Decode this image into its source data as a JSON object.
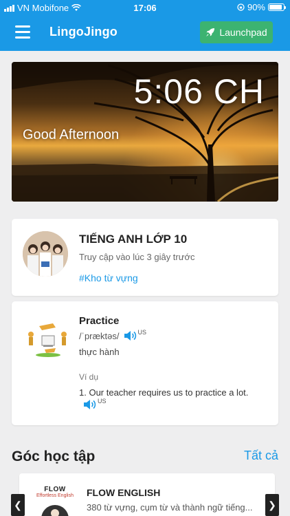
{
  "status_bar": {
    "carrier": "VN Mobifone",
    "time": "17:06",
    "battery": "90%",
    "battery_level": 0.9
  },
  "header": {
    "brand": "LingoJingo",
    "launch_label": "Launchpad"
  },
  "hero": {
    "time": "5:06 CH",
    "greeting": "Good Afternoon"
  },
  "course": {
    "title": "TIẾNG ANH LỚP 10",
    "access": "Truy cập vào lúc 3 giây trước",
    "tag": "#Kho từ vựng"
  },
  "word": {
    "term": "Practice",
    "phonetic": "/ˈpræktəs/",
    "accent": "US",
    "meaning": "thực hành",
    "example_label": "Ví dụ",
    "example": "1. Our teacher requires us to practice a lot.",
    "example_accent": "US"
  },
  "section": {
    "title": "Góc học tập",
    "all_label": "Tất cả"
  },
  "carousel": {
    "thumb_logo": "FLOW",
    "thumb_sub": "Effortless English",
    "title": "FLOW ENGLISH",
    "desc": "380 từ vựng, cụm từ và thành ngữ tiếng..."
  },
  "colors": {
    "primary": "#1a99e6",
    "launch": "#3cb371"
  },
  "icons": [
    "menu-icon",
    "rocket-icon",
    "speaker-icon",
    "wifi-icon",
    "battery-icon"
  ]
}
